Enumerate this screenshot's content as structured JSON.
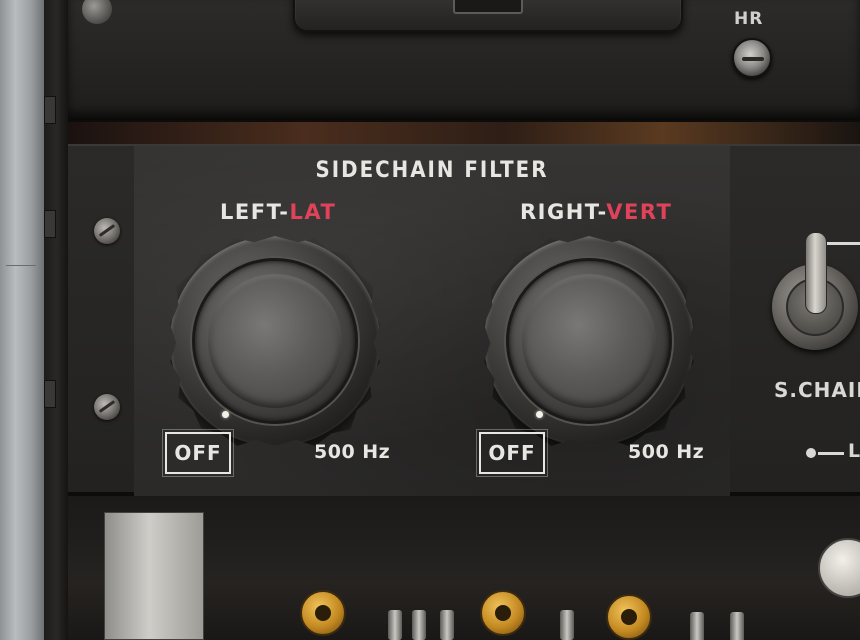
{
  "top": {
    "hr_label": "HR"
  },
  "sidechain_filter": {
    "title": "SIDECHAIN FILTER",
    "left": {
      "label_prefix": "LEFT-",
      "label_accent": "LAT",
      "off_label": "OFF",
      "frequency": "500 Hz"
    },
    "right": {
      "label_prefix": "RIGHT-",
      "label_accent": "VERT",
      "off_label": "OFF",
      "frequency": "500 Hz"
    }
  },
  "side_section": {
    "schain_label": "S.CHAIN",
    "lower_partial_label": "L"
  },
  "icons": [
    "screw-icon",
    "hr-button-icon",
    "toggle-switch-icon",
    "knob-indicator-icon"
  ],
  "colors": {
    "accent_red": "#e0425a",
    "label_text": "#e6e6e2",
    "panel_bg": "#323130"
  }
}
